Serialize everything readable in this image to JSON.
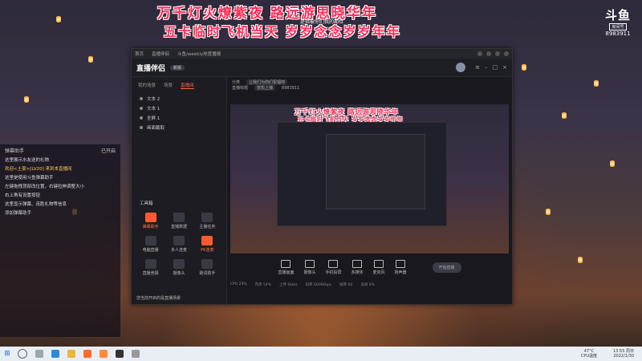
{
  "stream": {
    "banner_line1": "万千灯火燎紫夜 路远游思晓华年",
    "banner_line2": "五卡临时飞机当天 岁岁念念岁岁年年",
    "overlay_small": "是指被你们我的期待",
    "platform_logo": "斗鱼",
    "room_label": "房间号",
    "room_number": "8983911"
  },
  "chat": {
    "title": "弹幕助手",
    "settings_label": "已开启",
    "lines": [
      {
        "text": "这里展示水友送的礼物",
        "highlight": false
      },
      {
        "text": "欢迎<土豪>[LV20] 来到本直播间",
        "highlight": true
      },
      {
        "text": "这里是使用斗鱼弹幕助手",
        "highlight": false
      },
      {
        "text": "左键拖拽顶部改位置，右键拉伸调整大小",
        "highlight": false
      },
      {
        "text": "右上角有设置按钮",
        "highlight": false
      },
      {
        "text": "这里显示弹幕、连胜礼物等信息",
        "highlight": false
      },
      {
        "text": "添加弹幕助手",
        "highlight": false
      }
    ]
  },
  "window": {
    "tab1": "首页",
    "tab2": "直播伴侣",
    "tab3": "斗鱼/weekly热度播报",
    "app_name": "直播伴侣",
    "app_badge": "新版"
  },
  "sidebar": {
    "tabs": [
      "我的场景",
      "场景",
      "直播间"
    ],
    "active_tab": "直播间",
    "sources": [
      "文本 2",
      "文本 1",
      "全屏 1",
      "画面截取"
    ],
    "tools_title": "工具箱",
    "tools": [
      {
        "label": "弹幕助手",
        "hot": true
      },
      {
        "label": "直播数据",
        "hot": false
      },
      {
        "label": "主播任务",
        "hot": false
      },
      {
        "label": "电脑直播",
        "hot": false
      },
      {
        "label": "多人连麦",
        "hot": false
      },
      {
        "label": "PK连麦",
        "hot": true
      },
      {
        "label": "直播竞猜",
        "hot": false
      },
      {
        "label": "摄像头",
        "hot": false
      },
      {
        "label": "歌词助手",
        "hot": false
      }
    ],
    "notice": "您当前开启的是直播场景"
  },
  "content": {
    "category_label": "分类",
    "category_value": "让我们为你们祝福吧",
    "room_title_label": "直播标题",
    "room_title": "放松上播",
    "room_id": "8983911",
    "preview_banner1": "万千灯火燎紫夜 路远游思晓华年",
    "preview_banner2": "五卡临时飞机当天 岁岁念念岁岁年年"
  },
  "controls": {
    "items": [
      "直播画面",
      "摄像头",
      "手机投屏",
      "多媒体",
      "麦克风",
      "扬声器"
    ],
    "go_live": "开始直播",
    "status": [
      "CPU 23%",
      "内存 54%",
      "上传 0kb/s",
      "码率 6000kbps",
      "帧率 60",
      "丢帧 0%"
    ]
  },
  "taskbar": {
    "temp": "47°C",
    "cpu_label": "CPU温度",
    "time": "13:55 周日",
    "date": "2022/1/30"
  }
}
